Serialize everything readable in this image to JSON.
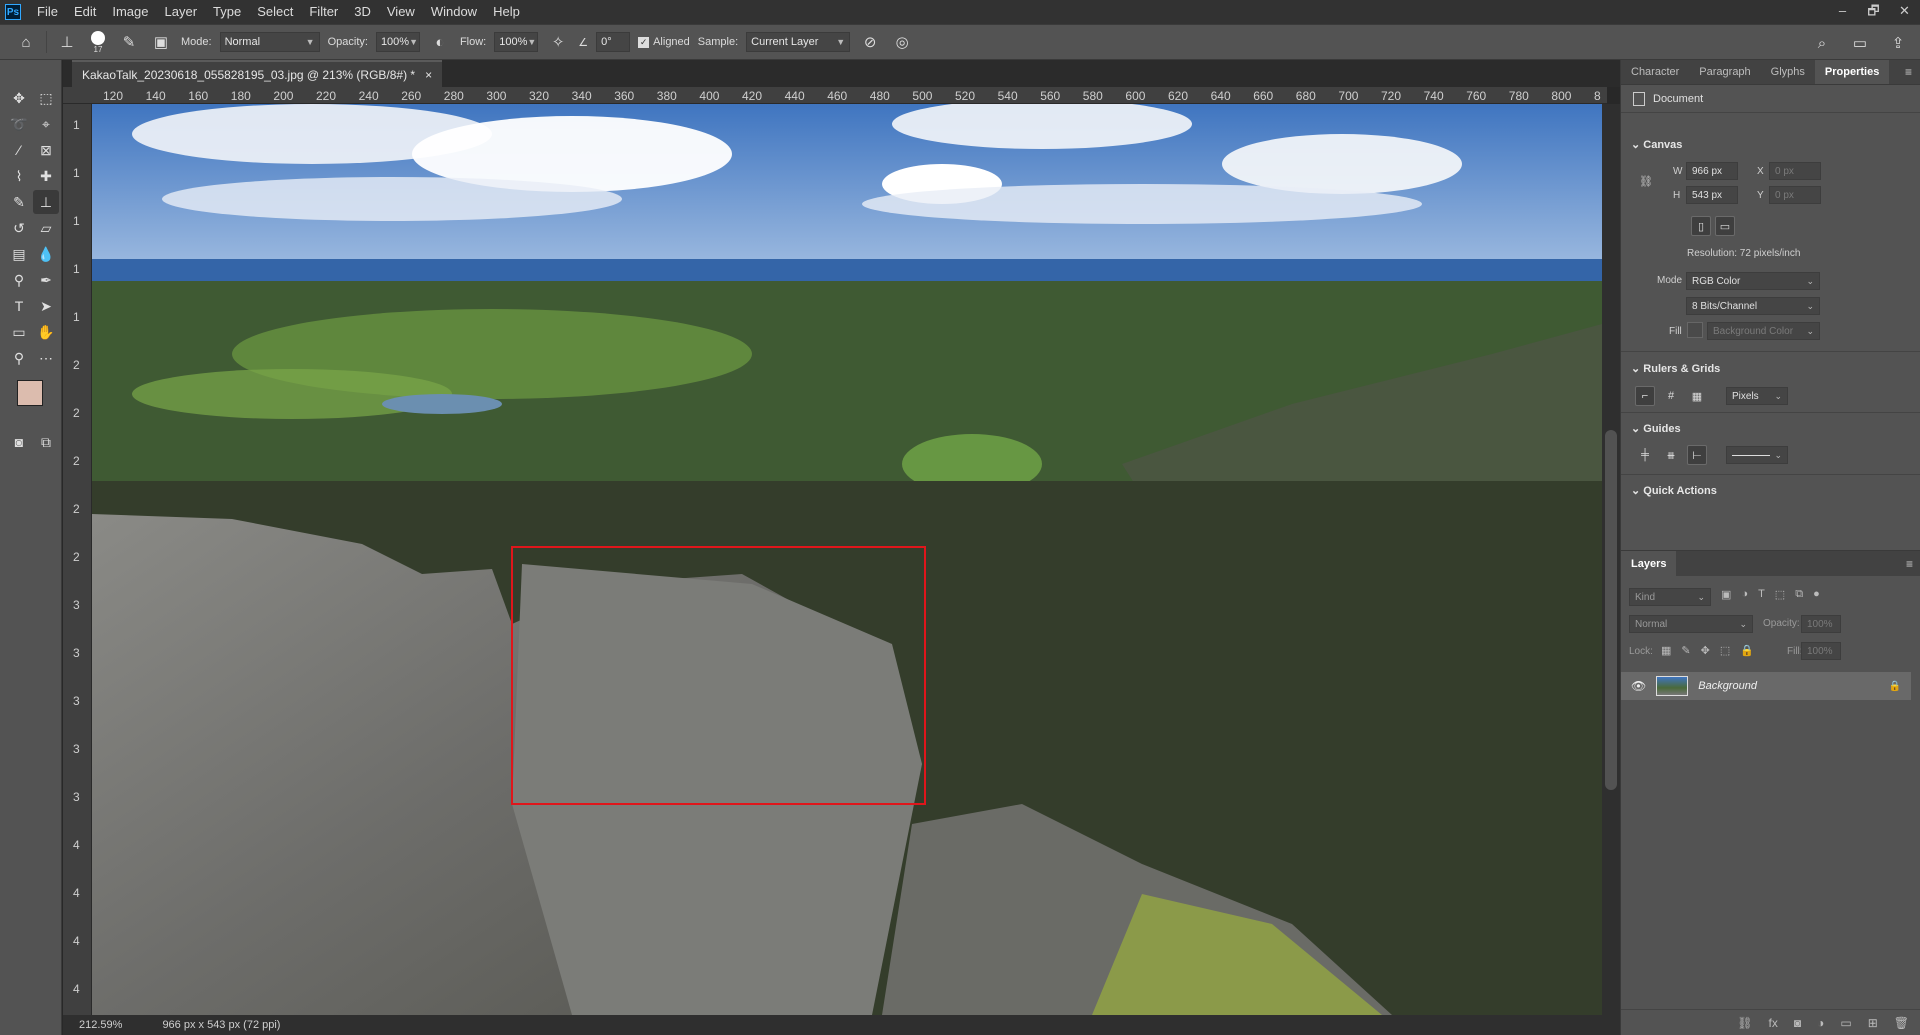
{
  "menu": {
    "logo": "Ps",
    "items": [
      "File",
      "Edit",
      "Image",
      "Layer",
      "Type",
      "Select",
      "Filter",
      "3D",
      "View",
      "Window",
      "Help"
    ],
    "window_controls": [
      "–",
      "🗗",
      "✕"
    ]
  },
  "options": {
    "brush_size": "17",
    "mode_label": "Mode:",
    "mode_value": "Normal",
    "opacity_label": "Opacity:",
    "opacity_value": "100%",
    "flow_label": "Flow:",
    "flow_value": "100%",
    "angle_value": "0°",
    "aligned_label": "Aligned",
    "sample_label": "Sample:",
    "sample_value": "Current Layer"
  },
  "document": {
    "tab_title": "KakaoTalk_20230618_055828195_03.jpg @ 213% (RGB/8#) *",
    "close": "×"
  },
  "ruler": {
    "h_ticks": [
      "120",
      "140",
      "160",
      "180",
      "200",
      "220",
      "240",
      "260",
      "280",
      "300",
      "320",
      "340",
      "360",
      "380",
      "400",
      "420",
      "440",
      "460",
      "480",
      "500",
      "520",
      "540",
      "560",
      "580",
      "600",
      "620",
      "640",
      "660",
      "680",
      "700",
      "720",
      "740",
      "760",
      "780",
      "800",
      "8"
    ],
    "v_ticks": [
      "1",
      "1",
      "1",
      "1",
      "1",
      "2",
      "2",
      "2",
      "2",
      "2",
      "3",
      "3",
      "3",
      "3",
      "3",
      "4",
      "4",
      "4",
      "4"
    ]
  },
  "status": {
    "zoom": "212.59%",
    "doc_info": "966 px x 543 px (72 ppi)"
  },
  "colors": {
    "foreground": "#dcbcae",
    "background": "#ffffff",
    "selection": "#e0161b"
  },
  "properties": {
    "tabs": [
      "Character",
      "Paragraph",
      "Glyphs",
      "Properties"
    ],
    "document_label": "Document",
    "canvas_section": "Canvas",
    "w_label": "W",
    "w_value": "966 px",
    "h_label": "H",
    "h_value": "543 px",
    "x_label": "X",
    "x_value": "0 px",
    "y_label": "Y",
    "y_value": "0 px",
    "resolution": "Resolution: 72 pixels/inch",
    "mode_label": "Mode",
    "mode_value": "RGB Color",
    "bits_value": "8 Bits/Channel",
    "fill_label": "Fill",
    "fill_value": "Background Color",
    "rulers_section": "Rulers & Grids",
    "units_value": "Pixels",
    "guides_section": "Guides",
    "quick_actions_section": "Quick Actions"
  },
  "layers": {
    "tab": "Layers",
    "kind_placeholder": "Kind",
    "blend_mode": "Normal",
    "opacity_label": "Opacity:",
    "opacity_value": "100%",
    "lock_label": "Lock:",
    "fill_label": "Fill:",
    "fill_value": "100%",
    "items": [
      {
        "name": "Background"
      }
    ]
  }
}
